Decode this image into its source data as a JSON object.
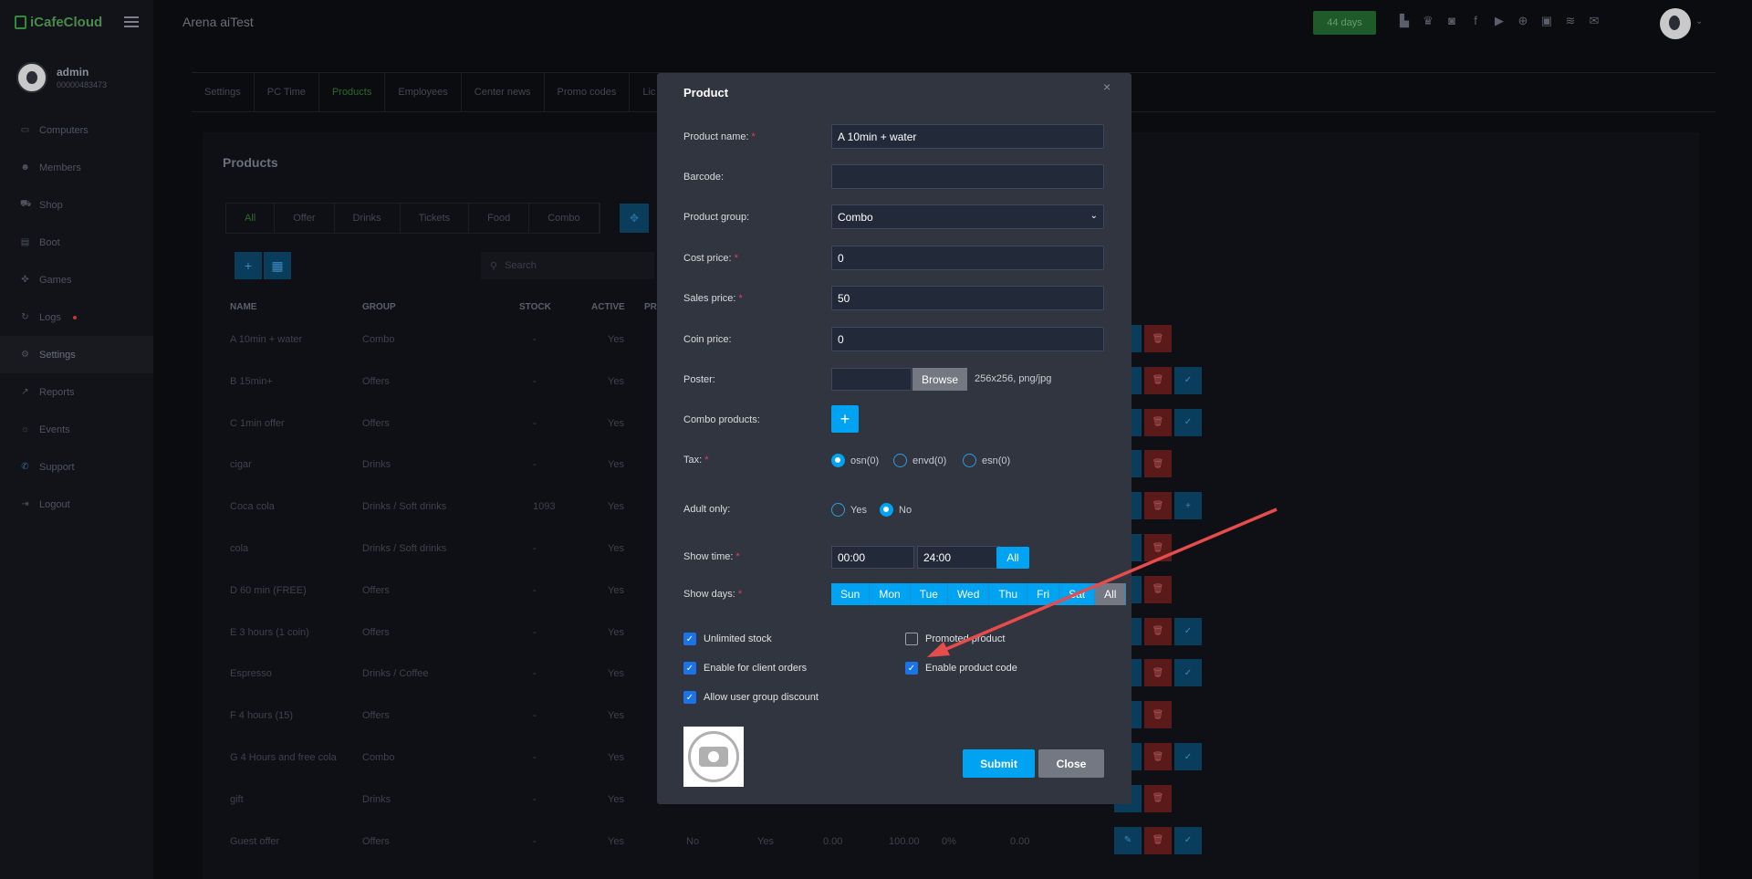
{
  "app": {
    "logo": "iCafeCloud",
    "title": "Arena aiTest",
    "days_badge": "44 days"
  },
  "user": {
    "name": "admin",
    "id": "00000483473"
  },
  "sidebar": {
    "items": [
      {
        "label": "Computers",
        "icon": "monitor-icon"
      },
      {
        "label": "Members",
        "icon": "users-icon"
      },
      {
        "label": "Shop",
        "icon": "cart-icon"
      },
      {
        "label": "Boot",
        "icon": "boot-icon"
      },
      {
        "label": "Games",
        "icon": "gamepad-icon"
      },
      {
        "label": "Logs",
        "icon": "log-icon"
      },
      {
        "label": "Settings",
        "icon": "gear-icon"
      },
      {
        "label": "Reports",
        "icon": "chart-icon"
      },
      {
        "label": "Events",
        "icon": "events-icon"
      },
      {
        "label": "Support",
        "icon": "phone-icon"
      },
      {
        "label": "Logout",
        "icon": "logout-icon"
      }
    ]
  },
  "tabs": [
    "Settings",
    "PC Time",
    "Products",
    "Employees",
    "Center news",
    "Promo codes",
    "Lic"
  ],
  "panel": {
    "title": "Products",
    "filters": [
      "All",
      "Offer",
      "Drinks",
      "Tickets",
      "Food",
      "Combo"
    ],
    "search_placeholder": "Search",
    "columns": [
      "NAME",
      "GROUP",
      "STOCK",
      "ACTIVE",
      "PR"
    ],
    "rows": [
      {
        "name": "A 10min + water",
        "group": "Combo",
        "stock": "-",
        "active": "Yes"
      },
      {
        "name": "B 15min+",
        "group": "Offers",
        "stock": "-",
        "active": "Yes"
      },
      {
        "name": "C 1min offer",
        "group": "Offers",
        "stock": "-",
        "active": "Yes"
      },
      {
        "name": "cigar",
        "group": "Drinks",
        "stock": "-",
        "active": "Yes"
      },
      {
        "name": "Coca cola",
        "group": "Drinks / Soft drinks",
        "stock": "1093",
        "active": "Yes"
      },
      {
        "name": "cola",
        "group": "Drinks / Soft drinks",
        "stock": "-",
        "active": "Yes"
      },
      {
        "name": "D 60 min (FREE)",
        "group": "Offers",
        "stock": "-",
        "active": "Yes"
      },
      {
        "name": "E 3 hours (1 coin)",
        "group": "Offers",
        "stock": "-",
        "active": "Yes"
      },
      {
        "name": "Espresso",
        "group": "Drinks / Coffee",
        "stock": "-",
        "active": "Yes"
      },
      {
        "name": "F 4 hours (15)",
        "group": "Offers",
        "stock": "-",
        "active": "Yes"
      },
      {
        "name": "G 4 Hours and free cola",
        "group": "Combo",
        "stock": "-",
        "active": "Yes"
      },
      {
        "name": "gift",
        "group": "Drinks",
        "stock": "-",
        "active": "Yes"
      },
      {
        "name": "Guest offer",
        "group": "Offers",
        "stock": "-",
        "active": "Yes"
      }
    ],
    "guest_extra": [
      "No",
      "Yes",
      "0.00",
      "100.00",
      "0%",
      "0.00"
    ]
  },
  "modal": {
    "title": "Product",
    "product_name_label": "Product name:",
    "product_name_value": "A 10min + water",
    "barcode_label": "Barcode:",
    "barcode_value": "",
    "group_label": "Product group:",
    "group_value": "Combo",
    "cost_label": "Cost price:",
    "cost_value": "0",
    "sales_label": "Sales price:",
    "sales_value": "50",
    "coin_label": "Coin price:",
    "coin_value": "0",
    "poster_label": "Poster:",
    "browse_label": "Browse",
    "poster_hint": "256x256, png/jpg",
    "combo_label": "Combo products:",
    "tax_label": "Tax:",
    "tax_options": [
      "osn(0)",
      "envd(0)",
      "esn(0)"
    ],
    "adult_label": "Adult only:",
    "adult_options": [
      "Yes",
      "No"
    ],
    "show_time_label": "Show time:",
    "time_from": "00:00",
    "time_to": "24:00",
    "time_all": "All",
    "show_days_label": "Show days:",
    "days": [
      "Sun",
      "Mon",
      "Tue",
      "Wed",
      "Thu",
      "Fri",
      "Sat",
      "All"
    ],
    "unlimited_stock": "Unlimited stock",
    "promoted_product": "Promoted product",
    "enable_client_orders": "Enable for client orders",
    "enable_product_code": "Enable product code",
    "allow_group_discount": "Allow user group discount",
    "submit_label": "Submit",
    "close_label": "Close"
  },
  "colors": {
    "accent": "#00a2f2",
    "modal_bg": "#31353f",
    "input_bg": "#222939",
    "arrow": "#e74c4c",
    "required": "#e0405a"
  }
}
